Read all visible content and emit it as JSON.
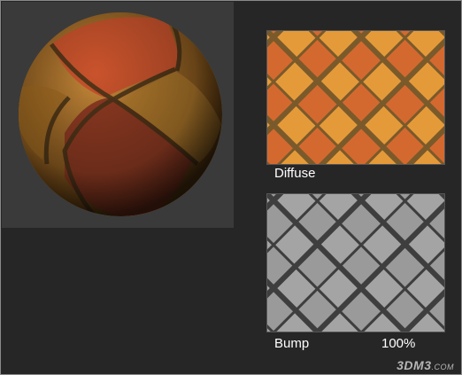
{
  "diffuse": {
    "label": "Diffuse"
  },
  "bump": {
    "label": "Bump",
    "amount": "100%"
  },
  "watermark": {
    "brand": "3DM3",
    "suffix": ".COM"
  },
  "colors": {
    "background": "#262626",
    "preview_panel": "#3a3a3a",
    "tile_orange": "#d4692f",
    "tile_light": "#e59a3a",
    "grout": "#7a5a2a",
    "bump_gray": "#9a9a9a"
  }
}
